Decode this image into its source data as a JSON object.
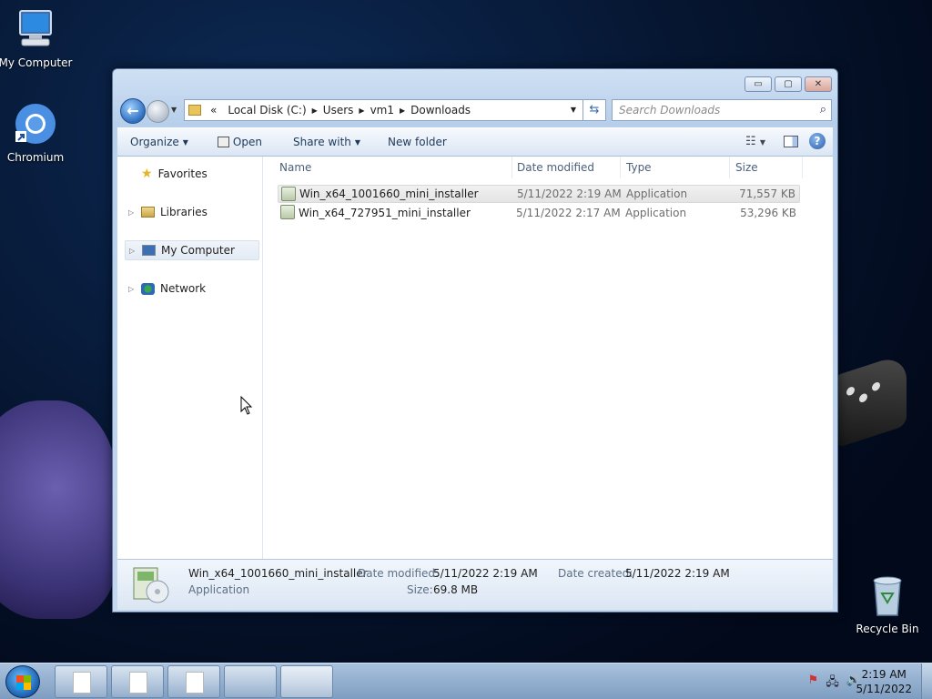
{
  "desktop": {
    "icons": [
      {
        "label": "My Computer"
      },
      {
        "label": "Chromium"
      },
      {
        "label": "Recycle Bin"
      }
    ]
  },
  "window": {
    "controls": {
      "minimize": "▭",
      "maximize": "▢",
      "close": "✕"
    },
    "address": {
      "overflow": "«",
      "segments": [
        "Local Disk (C:)",
        "Users",
        "vm1",
        "Downloads"
      ]
    },
    "search": {
      "placeholder": "Search Downloads"
    },
    "toolbar": {
      "organize": "Organize",
      "open": "Open",
      "share_with": "Share with",
      "new_folder": "New folder"
    },
    "nav_pane": [
      {
        "label": "Favorites",
        "selected": false
      },
      {
        "label": "Libraries",
        "selected": false
      },
      {
        "label": "My Computer",
        "selected": true
      },
      {
        "label": "Network",
        "selected": false
      }
    ],
    "columns": [
      "Name",
      "Date modified",
      "Type",
      "Size"
    ],
    "files": [
      {
        "name": "Win_x64_1001660_mini_installer",
        "date": "5/11/2022 2:19 AM",
        "type": "Application",
        "size": "71,557 KB",
        "selected": true
      },
      {
        "name": "Win_x64_727951_mini_installer",
        "date": "5/11/2022 2:17 AM",
        "type": "Application",
        "size": "53,296 KB",
        "selected": false
      }
    ],
    "details": {
      "name": "Win_x64_1001660_mini_installer",
      "type": "Application",
      "date_modified_label": "Date modified:",
      "date_modified": "5/11/2022 2:19 AM",
      "size_label": "Size:",
      "size": "69.8 MB",
      "date_created_label": "Date created:",
      "date_created": "5/11/2022 2:19 AM"
    }
  },
  "taskbar": {
    "clock": {
      "time": "2:19 AM",
      "date": "5/11/2022"
    }
  }
}
